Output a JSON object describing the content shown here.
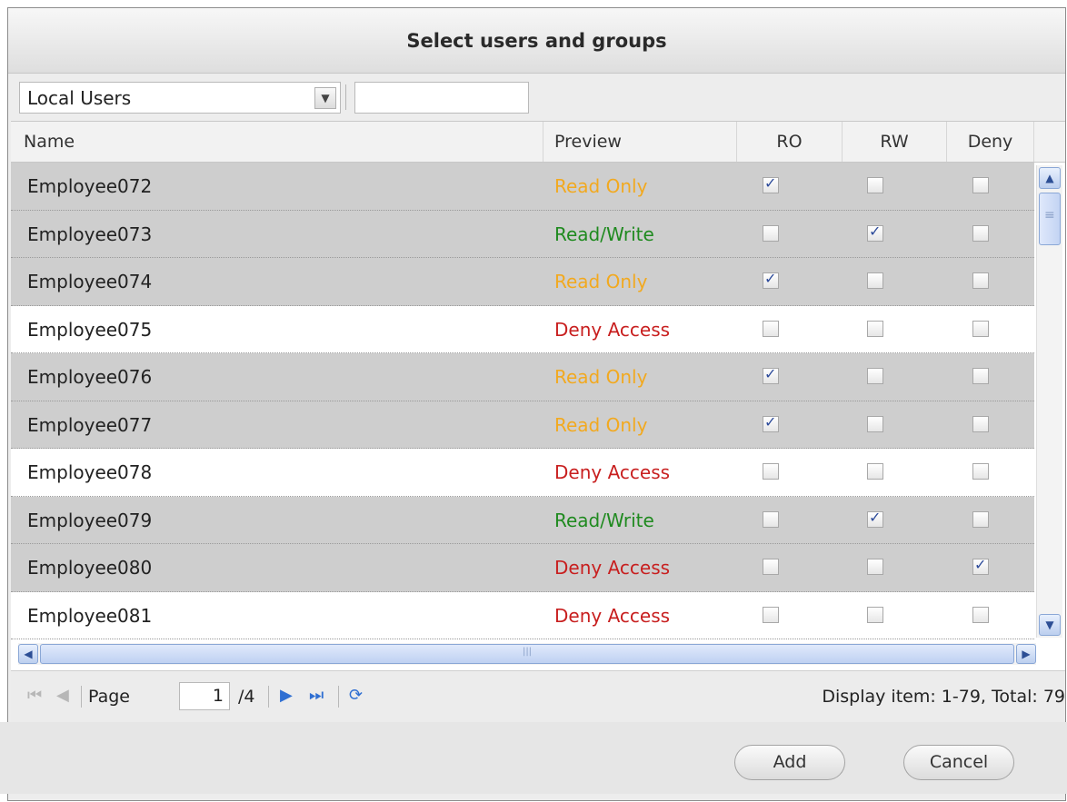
{
  "dialog": {
    "title": "Select users and groups"
  },
  "filter": {
    "selected": "Local Users",
    "search_value": ""
  },
  "columns": {
    "name": "Name",
    "preview": "Preview",
    "ro": "RO",
    "rw": "RW",
    "deny": "Deny"
  },
  "rows": [
    {
      "name": "Employee072",
      "preview": "Read Only",
      "ro": true,
      "rw": false,
      "deny": false,
      "shaded": true
    },
    {
      "name": "Employee073",
      "preview": "Read/Write",
      "ro": false,
      "rw": true,
      "deny": false,
      "shaded": true
    },
    {
      "name": "Employee074",
      "preview": "Read Only",
      "ro": true,
      "rw": false,
      "deny": false,
      "shaded": true
    },
    {
      "name": "Employee075",
      "preview": "Deny Access",
      "ro": false,
      "rw": false,
      "deny": false,
      "shaded": false
    },
    {
      "name": "Employee076",
      "preview": "Read Only",
      "ro": true,
      "rw": false,
      "deny": false,
      "shaded": true
    },
    {
      "name": "Employee077",
      "preview": "Read Only",
      "ro": true,
      "rw": false,
      "deny": false,
      "shaded": true
    },
    {
      "name": "Employee078",
      "preview": "Deny Access",
      "ro": false,
      "rw": false,
      "deny": false,
      "shaded": false
    },
    {
      "name": "Employee079",
      "preview": "Read/Write",
      "ro": false,
      "rw": true,
      "deny": false,
      "shaded": true
    },
    {
      "name": "Employee080",
      "preview": "Deny Access",
      "ro": false,
      "rw": false,
      "deny": true,
      "shaded": true
    },
    {
      "name": "Employee081",
      "preview": "Deny Access",
      "ro": false,
      "rw": false,
      "deny": false,
      "shaded": false
    }
  ],
  "preview_colors": {
    "Read Only": "#f2a91f",
    "Read/Write": "#1f8a1f",
    "Deny Access": "#c81f1f"
  },
  "pager": {
    "page_label": "Page",
    "current_page": "1",
    "total_pages": "/4",
    "display_info": "Display item: 1-79, Total: 79"
  },
  "buttons": {
    "add": "Add",
    "cancel": "Cancel"
  }
}
